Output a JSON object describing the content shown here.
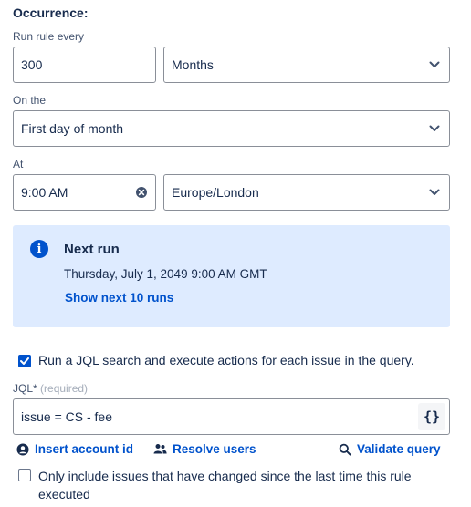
{
  "occurrence": {
    "title": "Occurrence:",
    "run_every_label": "Run rule every",
    "interval_value": "300",
    "interval_unit": "Months",
    "on_the_label": "On the",
    "on_the_value": "First day of month",
    "at_label": "At",
    "time_value": "9:00 AM",
    "timezone_value": "Europe/London"
  },
  "next_run": {
    "title": "Next run",
    "date": "Thursday, July 1, 2049 9:00 AM GMT",
    "show_more_link": "Show next 10 runs"
  },
  "jql_option": {
    "checked": true,
    "label": "Run a JQL search and execute actions for each issue in the query."
  },
  "jql": {
    "label": "JQL",
    "star": "*",
    "required_hint": "(required)",
    "value": "issue = CS - fee",
    "format_button": "{}"
  },
  "actions": {
    "insert_account_id": "Insert account id",
    "resolve_users": "Resolve users",
    "validate_query": "Validate query"
  },
  "changed_option": {
    "checked": false,
    "label_line1": "Only include issues that have changed since the last time this rule",
    "label_line2": "executed"
  },
  "colors": {
    "accent": "#0052cc",
    "panel_bg": "#deebff",
    "text": "#172b4d",
    "border": "#8a8f98"
  }
}
